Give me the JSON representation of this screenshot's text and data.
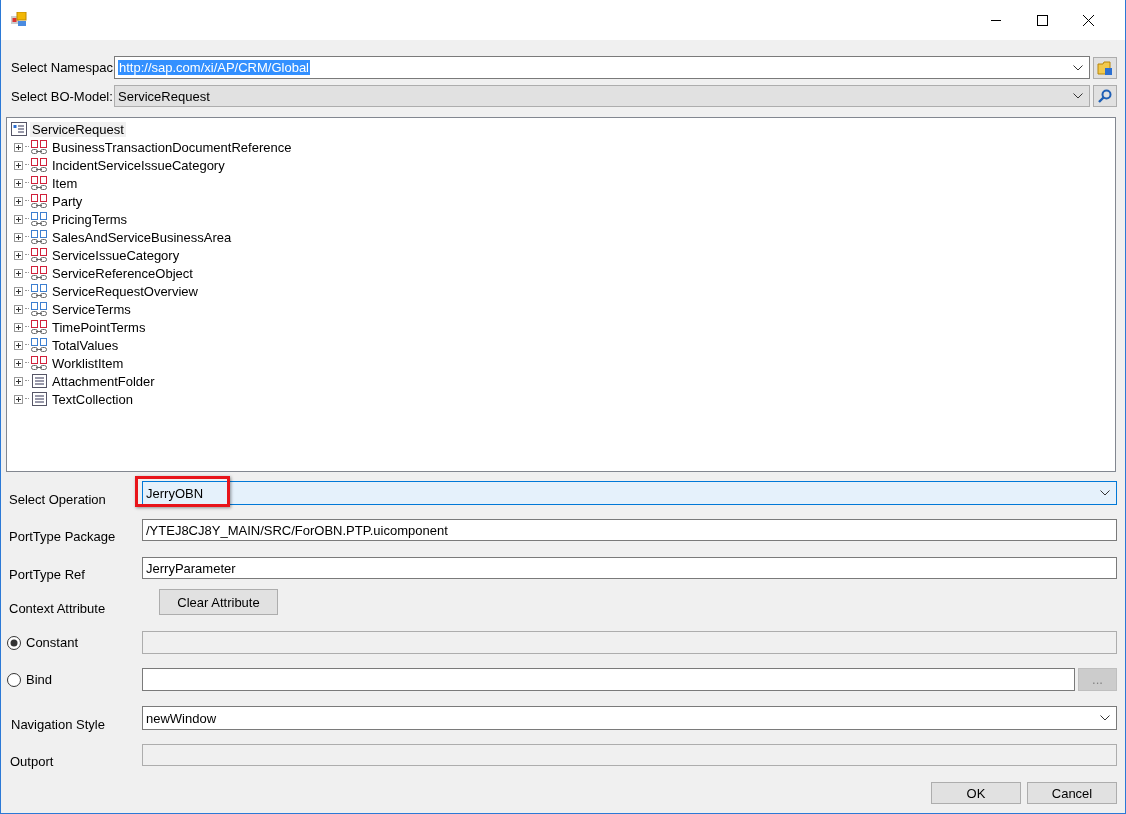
{
  "namespace": {
    "label": "Select Namespac",
    "value": "http://sap.com/xi/AP/CRM/Global",
    "text_selected": true
  },
  "bo_model": {
    "label": "Select BO-Model:",
    "value": "ServiceRequest"
  },
  "tree": {
    "root": {
      "label": "ServiceRequest",
      "children": [
        {
          "label": "BusinessTransactionDocumentReference",
          "kind": "red",
          "expanded": false
        },
        {
          "label": "IncidentServiceIssueCategory",
          "kind": "red",
          "expanded": false
        },
        {
          "label": "Item",
          "kind": "red",
          "expanded": false
        },
        {
          "label": "Party",
          "kind": "red",
          "expanded": false
        },
        {
          "label": "PricingTerms",
          "kind": "blue",
          "expanded": false
        },
        {
          "label": "SalesAndServiceBusinessArea",
          "kind": "blue",
          "expanded": false
        },
        {
          "label": "ServiceIssueCategory",
          "kind": "red",
          "expanded": false
        },
        {
          "label": "ServiceReferenceObject",
          "kind": "red",
          "expanded": false
        },
        {
          "label": "ServiceRequestOverview",
          "kind": "blue",
          "expanded": false
        },
        {
          "label": "ServiceTerms",
          "kind": "blue",
          "expanded": false
        },
        {
          "label": "TimePointTerms",
          "kind": "red",
          "expanded": false
        },
        {
          "label": "TotalValues",
          "kind": "blue",
          "expanded": false
        },
        {
          "label": "WorklistItem",
          "kind": "red",
          "expanded": false
        },
        {
          "label": "AttachmentFolder",
          "kind": "doc",
          "expanded": false
        },
        {
          "label": "TextCollection",
          "kind": "doc",
          "expanded": false
        }
      ]
    }
  },
  "operation": {
    "label": "Select Operation",
    "value": "JerryOBN",
    "highlighted": true
  },
  "porttype_package": {
    "label": "PortType Package",
    "value": "/YTEJ8CJ8Y_MAIN/SRC/ForOBN.PTP.uicomponent"
  },
  "porttype_ref": {
    "label": "PortType Ref",
    "value": "JerryParameter"
  },
  "context_attribute": {
    "label": "Context Attribute",
    "button": "Clear Attribute"
  },
  "options": [
    {
      "label": "Constant",
      "selected": true,
      "field_disabled": true
    },
    {
      "label": "Bind",
      "selected": false,
      "field_disabled": false,
      "button": {
        "label": "...",
        "disabled": true
      }
    }
  ],
  "navigation_style": {
    "label": "Navigation Style",
    "value": "newWindow"
  },
  "outport": {
    "label": "Outport",
    "disabled": true
  },
  "buttons": [
    "OK",
    "Cancel"
  ]
}
